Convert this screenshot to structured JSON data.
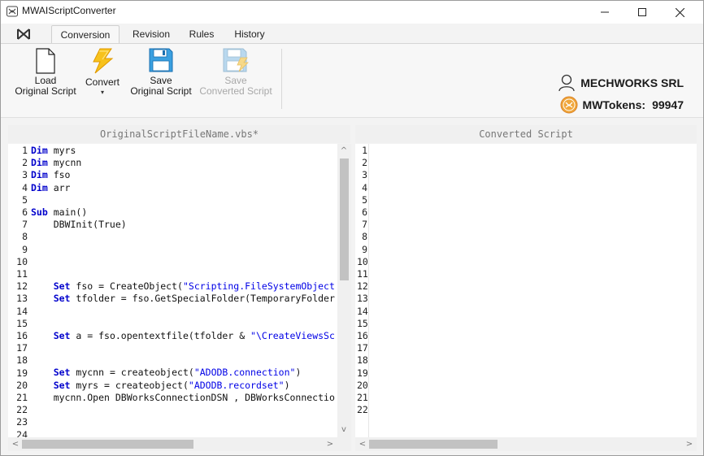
{
  "window": {
    "title": "MWAIScriptConverter",
    "controls": [
      "minimize",
      "maximize",
      "close"
    ]
  },
  "tabs": [
    {
      "label": "Conversion",
      "active": true
    },
    {
      "label": "Revision",
      "active": false
    },
    {
      "label": "Rules",
      "active": false
    },
    {
      "label": "History",
      "active": false
    }
  ],
  "ribbon": {
    "load": {
      "line1": "Load",
      "line2": "Original Script",
      "icon": "file-icon"
    },
    "convert": {
      "line1": "Convert",
      "caret": "▾",
      "icon": "lightning-icon"
    },
    "save_original": {
      "line1": "Save",
      "line2": "Original Script",
      "icon": "save-icon"
    },
    "save_converted": {
      "line1": "Save",
      "line2": "Converted Script",
      "icon": "save-lightning-icon",
      "enabled": false
    }
  },
  "account": {
    "company": "MECHWORKS SRL",
    "tokens_label": "MWTokens:",
    "tokens_value": "99947"
  },
  "left_editor": {
    "title": "OriginalScriptFileName.vbs*",
    "line_numbers": [
      "1",
      "2",
      "3",
      "4",
      "5",
      "6",
      "7",
      "8",
      "9",
      "10",
      "11",
      "12",
      "13",
      "14",
      "15",
      "16",
      "17",
      "18",
      "19",
      "20",
      "21",
      "22",
      "23",
      "24"
    ],
    "lines": [
      [
        {
          "t": "Dim",
          "c": "kw"
        },
        {
          "t": " myrs"
        }
      ],
      [
        {
          "t": "Dim",
          "c": "kw"
        },
        {
          "t": " mycnn"
        }
      ],
      [
        {
          "t": "Dim",
          "c": "kw"
        },
        {
          "t": " fso"
        }
      ],
      [
        {
          "t": "Dim",
          "c": "kw"
        },
        {
          "t": " arr"
        }
      ],
      [],
      [
        {
          "t": "Sub",
          "c": "kw"
        },
        {
          "t": " main()"
        }
      ],
      [
        {
          "t": "    DBWInit(True)"
        }
      ],
      [],
      [],
      [],
      [],
      [
        {
          "t": "    "
        },
        {
          "t": "Set",
          "c": "kw"
        },
        {
          "t": " fso = CreateObject("
        },
        {
          "t": "\"Scripting.FileSystemObject",
          "c": "str"
        }
      ],
      [
        {
          "t": "    "
        },
        {
          "t": "Set",
          "c": "kw"
        },
        {
          "t": " tfolder = fso.GetSpecialFolder(TemporaryFolder"
        }
      ],
      [],
      [],
      [
        {
          "t": "    "
        },
        {
          "t": "Set",
          "c": "kw"
        },
        {
          "t": " a = fso.opentextfile(tfolder & "
        },
        {
          "t": "\"\\CreateViewsSc",
          "c": "str"
        }
      ],
      [],
      [],
      [
        {
          "t": "    "
        },
        {
          "t": "Set",
          "c": "kw"
        },
        {
          "t": " mycnn = createobject("
        },
        {
          "t": "\"ADODB.connection\"",
          "c": "str"
        },
        {
          "t": ")"
        }
      ],
      [
        {
          "t": "    "
        },
        {
          "t": "Set",
          "c": "kw"
        },
        {
          "t": " myrs = createobject("
        },
        {
          "t": "\"ADODB.recordset\"",
          "c": "str"
        },
        {
          "t": ")"
        }
      ],
      [
        {
          "t": "    mycnn.Open DBWorksConnectionDSN , DBWorksConnectio"
        }
      ],
      [],
      [],
      []
    ]
  },
  "right_editor": {
    "title": "Converted Script",
    "line_numbers": [
      "1",
      "2",
      "3",
      "4",
      "5",
      "6",
      "7",
      "8",
      "9",
      "10",
      "11",
      "12",
      "13",
      "14",
      "15",
      "16",
      "17",
      "18",
      "19",
      "20",
      "21",
      "22"
    ]
  },
  "scroll_glyphs": {
    "up": "^",
    "down": "v",
    "left": "<",
    "right": ">"
  },
  "colors": {
    "keyword": "#0000cc",
    "string": "#0000e6",
    "accent": "#1e6fd9"
  }
}
